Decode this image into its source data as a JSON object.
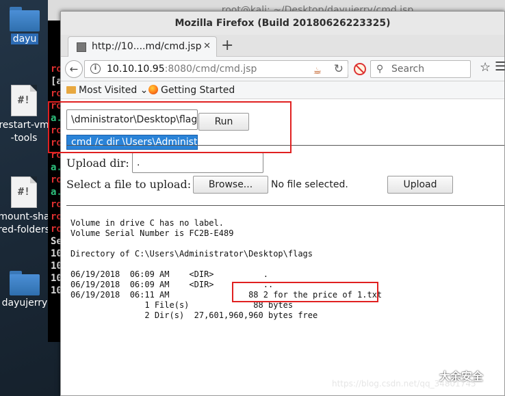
{
  "desktop": {
    "icons": [
      {
        "label": "dayu"
      },
      {
        "label": "restart-vm-tools"
      },
      {
        "label": "mount-shared-folders"
      },
      {
        "label": "dayujerry"
      }
    ]
  },
  "terminal": {
    "title": "root@kali: ~/Desktop/dayujerry/cmd.jsp",
    "fragments": [
      "ro",
      "[a",
      "ro",
      "ro",
      "a.",
      "ro",
      "ro",
      "ro",
      "a.",
      "ro",
      "a.",
      "ro",
      "ro",
      "ro",
      "Se",
      "10",
      "10",
      "10",
      "10"
    ]
  },
  "firefox": {
    "title": "Mozilla Firefox (Build 20180626223325)",
    "tab_label": "http://10....md/cmd.jsp",
    "url_host": "10.10.10.95",
    "url_path": ":8080/cmd/cmd.jsp",
    "search_placeholder": "Search",
    "bookmarks": {
      "most_visited": "Most Visited",
      "getting_started": "Getting Started"
    }
  },
  "page": {
    "cmd_value": "\\dministrator\\Desktop\\flags",
    "run_label": "Run",
    "autocomplete_item": "cmd /c dir \\Users\\Administ...",
    "upload_dir_label": "Upload dir:",
    "upload_dir_value": ".",
    "file_label": "Select a file to upload:",
    "browse_label": "Browse...",
    "no_file_text": "No file selected.",
    "upload_label": "Upload",
    "output_lines": [
      "Volume in drive C has no label.",
      "Volume Serial Number is FC2B-E489",
      "",
      "Directory of C:\\Users\\Administrator\\Desktop\\flags",
      "",
      "06/19/2018  06:09 AM    <DIR>          .",
      "06/19/2018  06:09 AM    <DIR>          ..",
      "06/19/2018  06:11 AM                88 2 for the price of 1.txt",
      "               1 File(s)             88 bytes",
      "               2 Dir(s)  27,601,960,960 bytes free"
    ]
  },
  "watermark": {
    "brand": "大余安全",
    "url": "https://blog.csdn.net/qq_34801745"
  },
  "colors": {
    "highlight_box": "#e02020",
    "autocomplete_bg": "#2a83d8"
  }
}
